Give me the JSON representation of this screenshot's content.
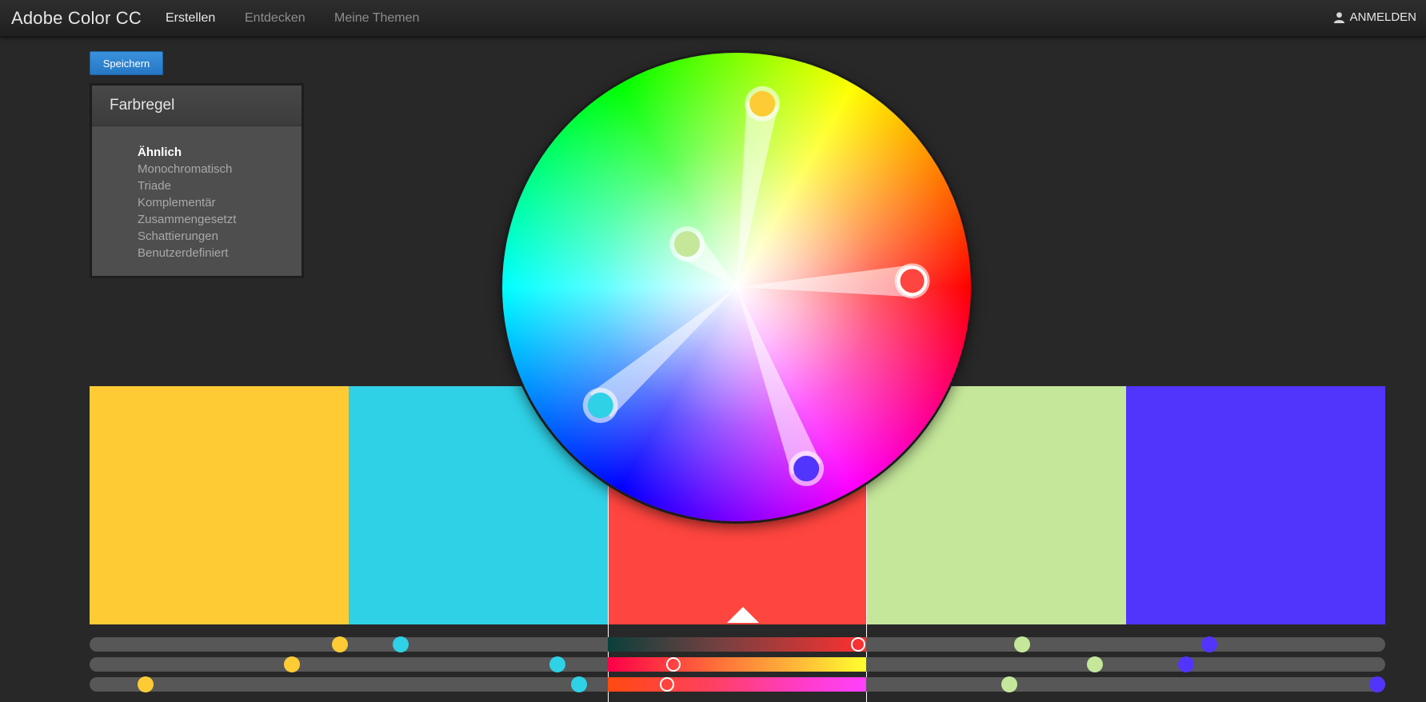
{
  "header": {
    "brand": "Adobe Color CC",
    "nav": [
      "Erstellen",
      "Entdecken",
      "Meine Themen"
    ],
    "sign_in": "ANMELDEN"
  },
  "toolbar": {
    "save_label": "Speichern"
  },
  "color_rule": {
    "title": "Farbregel",
    "options": [
      "Ähnlich",
      "Monochromatisch",
      "Triade",
      "Komplementär",
      "Zusammengesetzt",
      "Schattierungen",
      "Benutzerdefiniert"
    ],
    "selected": "Ähnlich"
  },
  "swatches": [
    {
      "color": "#ffcb35"
    },
    {
      "color": "#2ed1e6"
    },
    {
      "color": "#ff453f"
    },
    {
      "color": "#c4e79a"
    },
    {
      "color": "#5235fc"
    }
  ],
  "selected_swatch": 2,
  "sliders": [
    {
      "gradient": "linear-gradient(to right,#0b3f3c,#7a4040 45%,#ff3030)",
      "selected_value": 0.97,
      "knobs": [
        0.193,
        0.24,
        0.72,
        0.864
      ]
    },
    {
      "gradient": "linear-gradient(to right,#ff0048,#ff6a3a 40%,#ffb03a 70%,#ffff2e)",
      "selected_value": 0.255,
      "knobs": [
        0.156,
        0.361,
        0.776,
        0.846
      ]
    },
    {
      "gradient": "linear-gradient(to right,#ff4a10,#ff4060 40%,#ff3cc8 75%,#ff40ff)",
      "selected_value": 0.23,
      "knobs": [
        0.043,
        0.378,
        0.71,
        0.994
      ]
    }
  ],
  "wheel": {
    "handles": [
      {
        "angle_deg": 82,
        "radius_frac": 0.79,
        "color": "#ffcb35",
        "selected": false
      },
      {
        "angle_deg": 139,
        "radius_frac": 0.28,
        "color": "#c4e79a",
        "selected": false
      },
      {
        "angle_deg": 2,
        "radius_frac": 0.75,
        "color": "#ff453f",
        "selected": true
      },
      {
        "angle_deg": 221,
        "radius_frac": 0.77,
        "color": "#2ed1e6",
        "selected": false
      },
      {
        "angle_deg": 291,
        "radius_frac": 0.83,
        "color": "#5235fc",
        "selected": false
      }
    ]
  }
}
